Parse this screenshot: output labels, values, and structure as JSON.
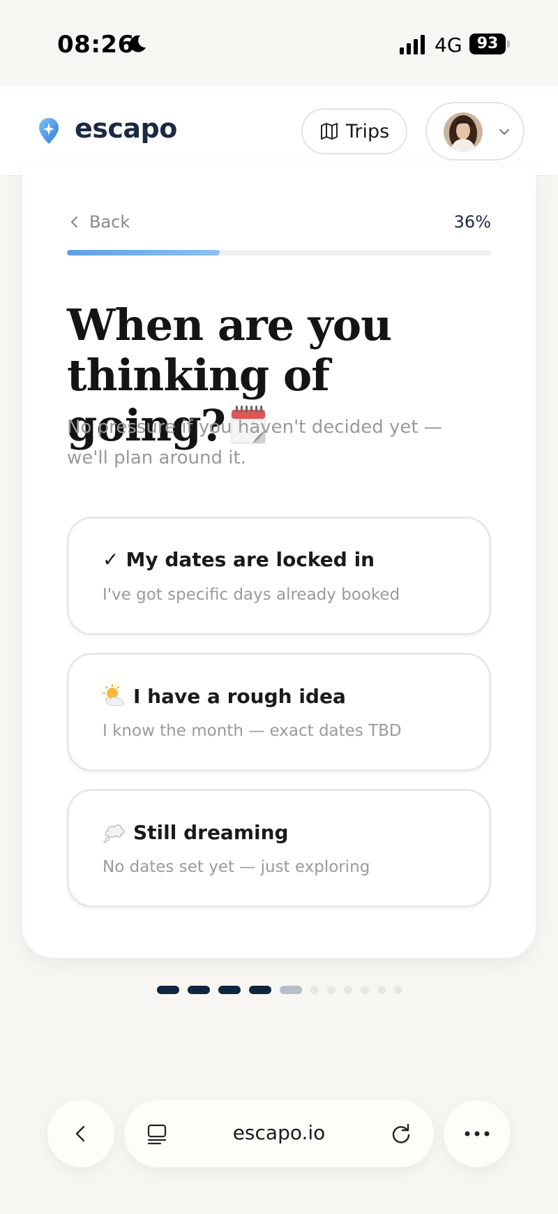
{
  "status_bar": {
    "time": "08:26",
    "network": "4G",
    "battery": "93"
  },
  "header": {
    "logo_text": "escapo",
    "trips_label": "Trips"
  },
  "progress": {
    "back_label": "Back",
    "percent_label": "36%",
    "value": 0.36
  },
  "question": {
    "title": "When are you thinking of going?",
    "subtitle": "No pressure if you haven't decided yet — we'll plan around it."
  },
  "options": [
    {
      "icon": "check-icon",
      "prefix": "✓",
      "title": "My dates are locked in",
      "description": "I've got specific days already booked"
    },
    {
      "icon": "sun-cloud-icon",
      "prefix": "",
      "title": "I have a rough idea",
      "description": "I know the month — exact dates TBD"
    },
    {
      "icon": "thought-bubble-icon",
      "prefix": "",
      "title": "Still dreaming",
      "description": "No dates set yet — just exploring"
    }
  ],
  "steps": {
    "total": 11,
    "completed": 4,
    "current": 5
  },
  "browser": {
    "url": "escapo.io"
  },
  "colors": {
    "brand_dark": "#1b2a44",
    "progress": "#5fa0e6",
    "step_done": "#0f2540",
    "step_current": "#b8bec8",
    "step_todo": "#e7e6e3"
  }
}
